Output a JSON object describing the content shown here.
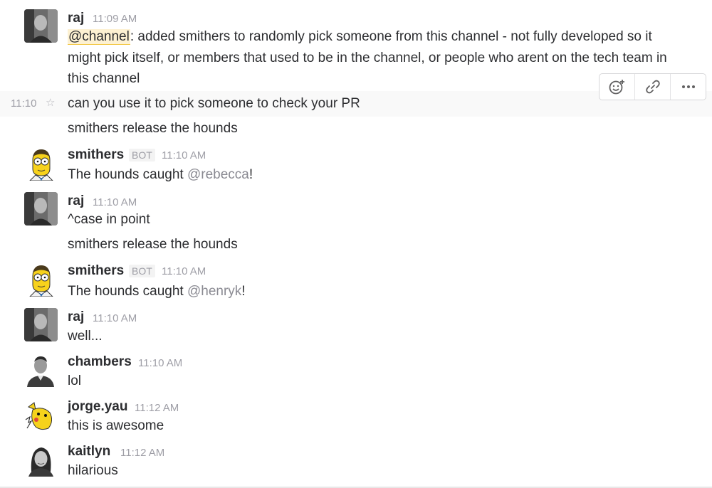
{
  "messages": {
    "m1": {
      "author": "raj",
      "time": "11:09 AM",
      "mention": "@channel",
      "line1_rest": ": added smithers to randomly pick someone from this channel - not fully developed so it",
      "line2": "might pick itself, or members that used to be in the channel, or people who arent on the tech team in",
      "line3": "this channel"
    },
    "m2": {
      "time": "11:10",
      "text": "can you use it to pick someone to check your PR"
    },
    "m3": {
      "text": "smithers release the hounds"
    },
    "m4": {
      "author": "smithers",
      "badge": "BOT",
      "time": "11:10 AM",
      "text_pre": "The hounds caught ",
      "mention": "@rebecca",
      "text_post": "!"
    },
    "m5": {
      "author": "raj",
      "time": "11:10 AM",
      "text": "^case in point"
    },
    "m6": {
      "text": "smithers release the hounds"
    },
    "m7": {
      "author": "smithers",
      "badge": "BOT",
      "time": "11:10 AM",
      "text_pre": "The hounds caught ",
      "mention": "@henryk",
      "text_post": "!"
    },
    "m8": {
      "author": "raj",
      "time": "11:10 AM",
      "text": "well..."
    },
    "m9": {
      "author": "chambers",
      "time": "11:10 AM",
      "text": "lol"
    },
    "m10": {
      "author": "jorge.yau",
      "time": "11:12 AM",
      "text": "this is awesome"
    },
    "m11": {
      "author": "kaitlyn",
      "time": "11:12 AM",
      "text": "hilarious"
    }
  },
  "actions": [
    "add-reaction-icon",
    "copy-link-icon",
    "more-actions-icon"
  ],
  "colors": {
    "mention_highlight": "#fdf1d2",
    "timestamp": "#9e9ea6",
    "text": "#2c2d30"
  }
}
